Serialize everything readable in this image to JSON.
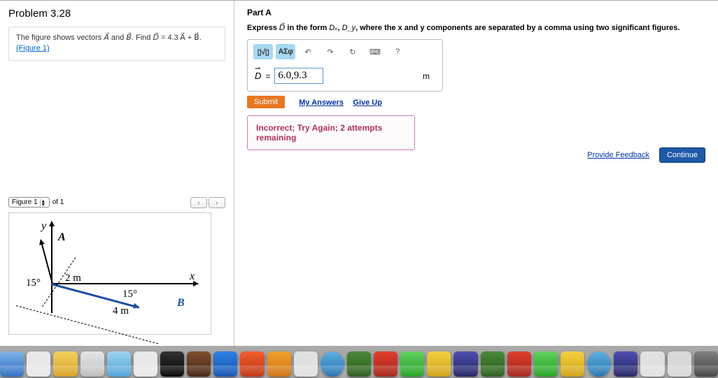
{
  "problem": {
    "title": "Problem 3.28",
    "statement_pre": "The figure shows vectors ",
    "statement_mid": " and ",
    "statement_post": ". Find ",
    "vec_a": "A⃗",
    "vec_b": "B⃗",
    "vec_d": "D⃗",
    "equation_rhs": " = 4.3 A⃗ + B⃗.",
    "figure_link": "(Figure 1)"
  },
  "figure_bar": {
    "select_label": "Figure 1",
    "of_text": "of 1",
    "prev": "‹",
    "next": "›"
  },
  "figure": {
    "y_label": "y",
    "x_label": "x",
    "a_label": "A⃗",
    "b_label": "B⃗",
    "angle1": "15°",
    "angle2": "15°",
    "len_a": "2 m",
    "len_b": "4 m"
  },
  "partA": {
    "label": "Part A",
    "instr_pre": "Express ",
    "instr_vec": "D⃗",
    "instr_mid": " in the form ",
    "instr_dx": "Dₓ",
    "instr_comma": ", ",
    "instr_dy": "D_y",
    "instr_post": ", where the x and y components are separated by a comma using two significant figures.",
    "toolbar": {
      "templates": "▯√▯",
      "greek": "ΑΣφ",
      "undo": "↶",
      "redo": "↷",
      "reset": "↻",
      "keyboard": "⌨",
      "help": "?"
    },
    "answer_vec": "D",
    "equals": " = ",
    "answer_value": "6.0,9.3",
    "unit": "m",
    "submit": "Submit",
    "my_answers": "My Answers",
    "give_up": "Give Up",
    "feedback": "Incorrect; Try Again; 2 attempts remaining"
  },
  "footer": {
    "provide": "Provide Feedback",
    "continue": "Continue"
  }
}
